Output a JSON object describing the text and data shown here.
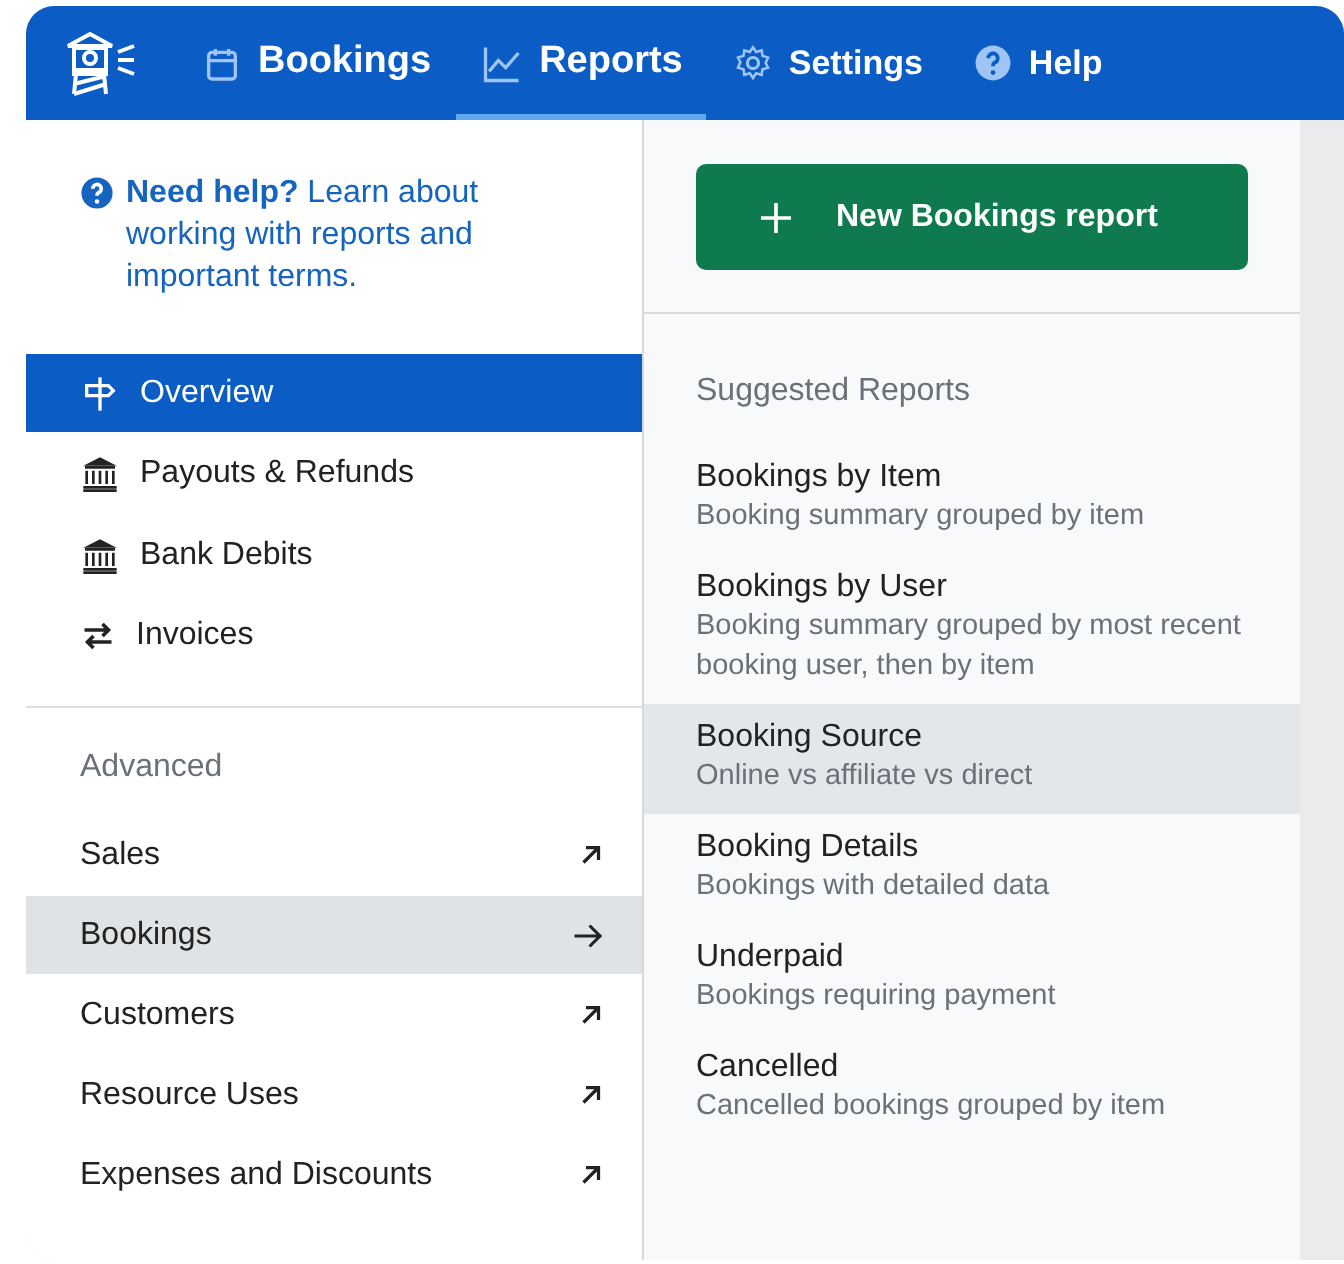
{
  "navbar": {
    "tabs": [
      {
        "label": "Bookings",
        "selected": false
      },
      {
        "label": "Reports",
        "selected": true
      },
      {
        "label": "Settings",
        "selected": false
      },
      {
        "label": "Help",
        "selected": false
      }
    ]
  },
  "help_text": "**Need help?** Learn about working with reports and important terms.",
  "menu": [
    {
      "label": "Overview",
      "selected": true
    },
    {
      "label": "Payouts & Refunds",
      "selected": false
    },
    {
      "label": "Bank Debits",
      "selected": false
    },
    {
      "label": "Invoices",
      "selected": false
    }
  ],
  "advanced": {
    "heading": "Advanced",
    "items": [
      {
        "label": "Sales",
        "kind": "external",
        "selected": false
      },
      {
        "label": "Bookings",
        "kind": "submenu",
        "selected": true
      },
      {
        "label": "Customers",
        "kind": "external",
        "selected": false
      },
      {
        "label": "Resource Uses",
        "kind": "external",
        "selected": false
      },
      {
        "label": "Expenses and Discounts",
        "kind": "external",
        "selected": false
      }
    ]
  },
  "new_report_button": "New Bookings report",
  "suggested": {
    "heading": "Suggested Reports",
    "items": [
      {
        "title": "Bookings by Item",
        "description": "Booking summary grouped by item",
        "selected": false
      },
      {
        "title": "Bookings by User",
        "description": "Booking summary grouped by most recent booking user, then by item",
        "selected": false
      },
      {
        "title": "Booking Source",
        "description": "Online vs affiliate vs direct",
        "selected": true
      },
      {
        "title": "Booking Details",
        "description": "Bookings with detailed data",
        "selected": false
      },
      {
        "title": "Underpaid",
        "description": "Bookings requiring payment",
        "selected": false
      },
      {
        "title": "Cancelled",
        "description": "Cancelled bookings grouped by item",
        "selected": false
      }
    ]
  }
}
